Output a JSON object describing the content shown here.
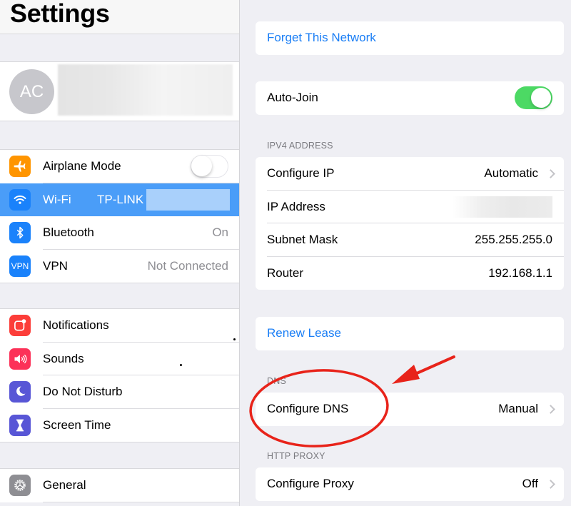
{
  "sidebar": {
    "title": "Settings",
    "profile": {
      "initials": "AC"
    },
    "groups": [
      {
        "items": [
          {
            "label": "Airplane Mode",
            "icon": "airplane-icon",
            "color": "#ff9500",
            "toggle": false
          },
          {
            "label": "Wi-Fi",
            "icon": "wifi-icon",
            "color": "#1a82fb",
            "value": "TP-LINK",
            "selected": true
          },
          {
            "label": "Bluetooth",
            "icon": "bluetooth-icon",
            "color": "#1a82fb",
            "value": "On"
          },
          {
            "label": "VPN",
            "icon": "vpn-icon",
            "color": "#1a82fb",
            "value": "Not Connected",
            "icon_text": "VPN"
          }
        ]
      },
      {
        "items": [
          {
            "label": "Notifications",
            "icon": "notifications-icon",
            "color": "#fc3d39"
          },
          {
            "label": "Sounds",
            "icon": "sounds-icon",
            "color": "#fc3158"
          },
          {
            "label": "Do Not Disturb",
            "icon": "moon-icon",
            "color": "#5856d6"
          },
          {
            "label": "Screen Time",
            "icon": "hourglass-icon",
            "color": "#5856d6"
          }
        ]
      },
      {
        "items": [
          {
            "label": "General",
            "icon": "gear-icon",
            "color": "#8e8e93"
          }
        ]
      }
    ]
  },
  "detail": {
    "forget_network": "Forget This Network",
    "auto_join": {
      "label": "Auto-Join",
      "on": true
    },
    "ipv4_header": "IPV4 ADDRESS",
    "ipv4": [
      {
        "label": "Configure IP",
        "value": "Automatic",
        "chevron": true
      },
      {
        "label": "IP Address",
        "value": ""
      },
      {
        "label": "Subnet Mask",
        "value": "255.255.255.0"
      },
      {
        "label": "Router",
        "value": "192.168.1.1"
      }
    ],
    "renew_lease": "Renew Lease",
    "dns_header": "DNS",
    "configure_dns": {
      "label": "Configure DNS",
      "value": "Manual"
    },
    "proxy_header": "HTTP PROXY",
    "configure_proxy": {
      "label": "Configure Proxy",
      "value": "Off"
    }
  },
  "colors": {
    "accent": "#1a7ef5",
    "toggle_on": "#4cd964",
    "selection": "#4a9df8",
    "annotation": "#e8231a"
  },
  "annotation": {
    "target": "Configure DNS",
    "shapes": [
      "ellipse",
      "arrow"
    ]
  }
}
